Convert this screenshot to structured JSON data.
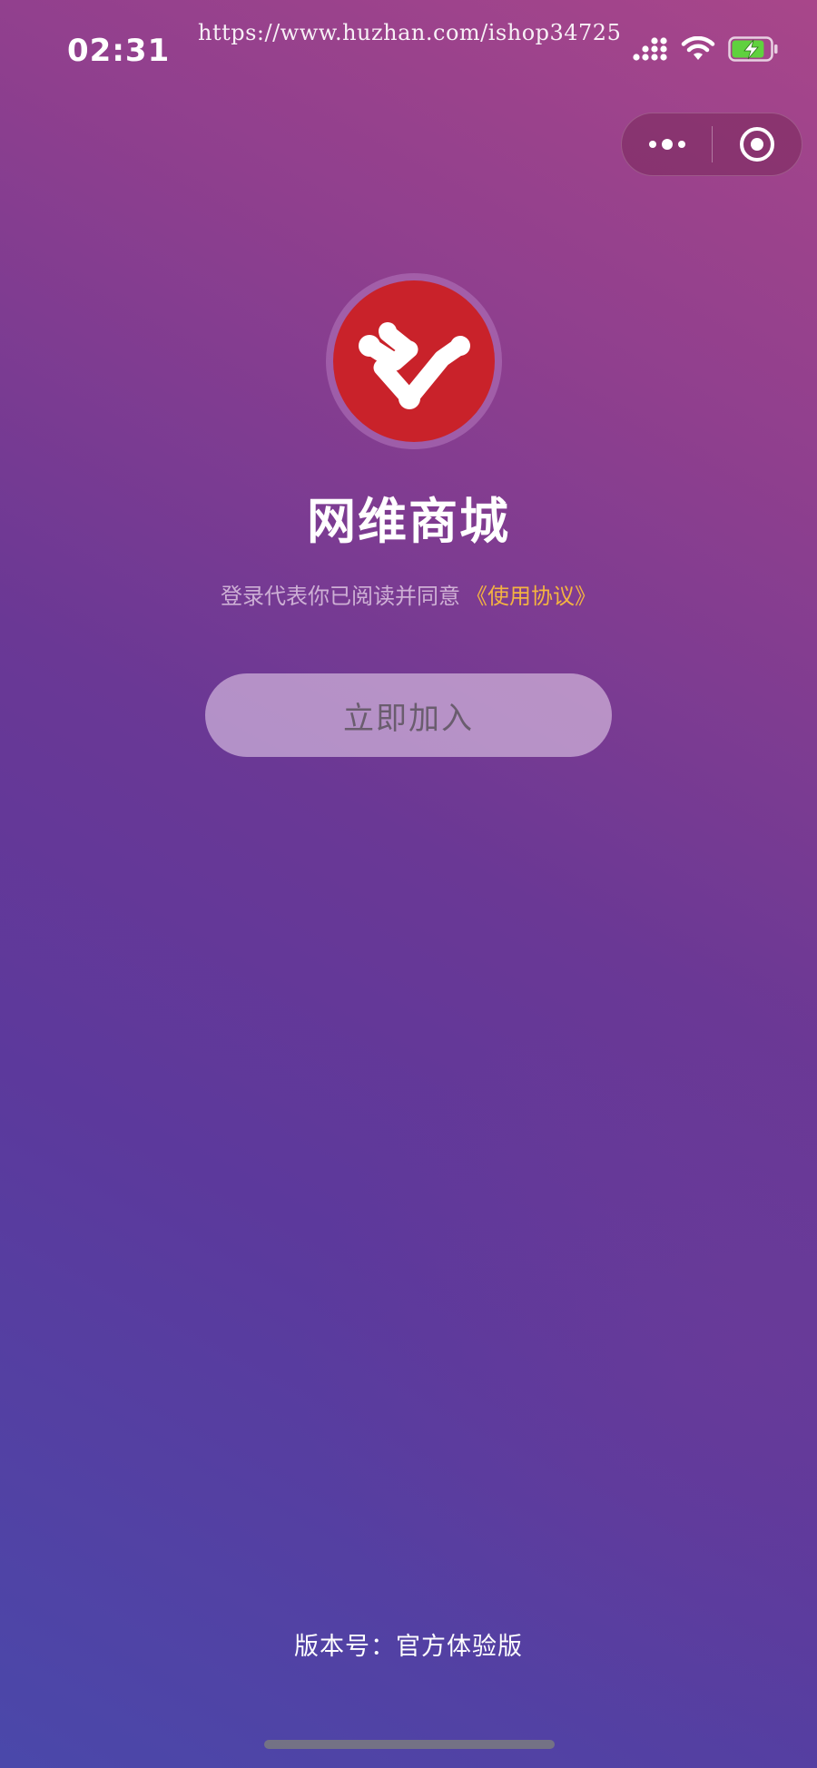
{
  "status_bar": {
    "time": "02:31",
    "watermark": "https://www.huzhan.com/ishop34725",
    "battery_level": 0.85,
    "battery_charging": true
  },
  "capsule": {
    "more_icon": "more-dots-icon",
    "close_icon": "target-circle-icon"
  },
  "app": {
    "name": "网维商城",
    "logo_icon": "network-v-logo-icon",
    "logo_color": "#c9222a"
  },
  "agreement": {
    "prefix": "登录代表你已阅读并同意",
    "link": "《使用协议》",
    "link_color": "#f4b341"
  },
  "join_button": {
    "label": "立即加入"
  },
  "footer": {
    "version": "版本号：官方体验版"
  },
  "colors": {
    "gradient_top": "#a8468a",
    "gradient_mid": "#6a3895",
    "gradient_bottom": "#4a48aa"
  }
}
